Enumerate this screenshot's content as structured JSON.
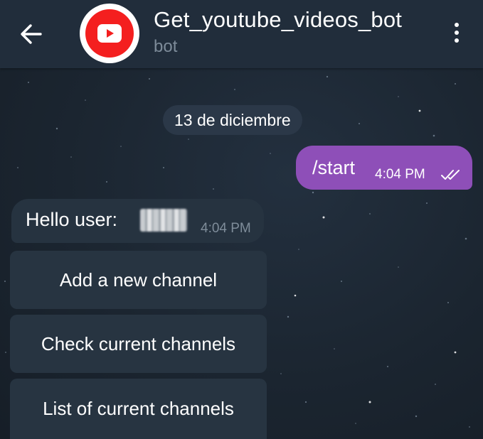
{
  "header": {
    "title": "Get_youtube_videos_bot",
    "subtitle": "bot",
    "back_icon": "arrow-left-icon",
    "menu_icon": "more-vertical-icon",
    "avatar_icon": "youtube-play-icon",
    "avatar_color": "#f41f1f"
  },
  "chat": {
    "date_separator": "13 de diciembre",
    "outgoing": {
      "text": "/start",
      "time": "4:04 PM",
      "status_icon": "double-check-icon",
      "bubble_color": "#8e4fb8"
    },
    "incoming": {
      "text": "Hello user:",
      "time": "4:04 PM"
    },
    "keyboard": [
      {
        "label": "Add a new channel"
      },
      {
        "label": "Check current channels"
      },
      {
        "label": "List of current channels"
      }
    ]
  },
  "colors": {
    "header_bg": "#212d3b",
    "chat_bg": "#1b2530",
    "incoming_bubble": "#263340",
    "keyboard_button": "#273441"
  }
}
